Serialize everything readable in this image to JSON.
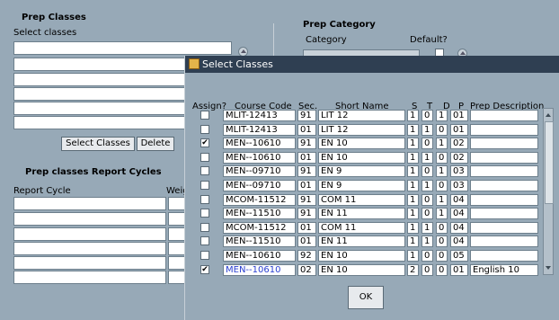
{
  "background": {
    "prep_classes_title": "Prep Classes",
    "select_classes_label": "Select classes",
    "select_classes_button": "Select Classes",
    "delete_button": "Delete",
    "report_cycles_title": "Prep classes Report Cycles",
    "report_cycle_col": "Report Cycle",
    "weight_col": "Weig",
    "prep_category_title": "Prep Category",
    "category_label": "Category",
    "default_label": "Default?"
  },
  "dialog": {
    "title": "Select Classes",
    "headers": {
      "assign": "Assign?",
      "course_code": "Course Code",
      "sec": "Sec.",
      "short_name": "Short Name",
      "s": "S",
      "t": "T",
      "d": "D",
      "p": "P",
      "prep_description": "Prep Description"
    },
    "rows": [
      {
        "assign": false,
        "code": "MLIT-12413",
        "sec": "91",
        "short": "LIT 12",
        "s": "1",
        "t": "0",
        "d": "1",
        "p": "01",
        "desc": ""
      },
      {
        "assign": false,
        "code": "MLIT-12413",
        "sec": "01",
        "short": "LIT 12",
        "s": "1",
        "t": "1",
        "d": "0",
        "p": "01",
        "desc": ""
      },
      {
        "assign": true,
        "code": "MEN--10610",
        "sec": "91",
        "short": "EN 10",
        "s": "1",
        "t": "0",
        "d": "1",
        "p": "02",
        "desc": ""
      },
      {
        "assign": false,
        "code": "MEN--10610",
        "sec": "01",
        "short": "EN 10",
        "s": "1",
        "t": "1",
        "d": "0",
        "p": "02",
        "desc": ""
      },
      {
        "assign": false,
        "code": "MEN--09710",
        "sec": "91",
        "short": "EN 9",
        "s": "1",
        "t": "0",
        "d": "1",
        "p": "03",
        "desc": ""
      },
      {
        "assign": false,
        "code": "MEN--09710",
        "sec": "01",
        "short": "EN 9",
        "s": "1",
        "t": "1",
        "d": "0",
        "p": "03",
        "desc": ""
      },
      {
        "assign": false,
        "code": "MCOM-11512",
        "sec": "91",
        "short": "COM 11",
        "s": "1",
        "t": "0",
        "d": "1",
        "p": "04",
        "desc": ""
      },
      {
        "assign": false,
        "code": "MEN--11510",
        "sec": "91",
        "short": "EN 11",
        "s": "1",
        "t": "0",
        "d": "1",
        "p": "04",
        "desc": ""
      },
      {
        "assign": false,
        "code": "MCOM-11512",
        "sec": "01",
        "short": "COM 11",
        "s": "1",
        "t": "1",
        "d": "0",
        "p": "04",
        "desc": ""
      },
      {
        "assign": false,
        "code": "MEN--11510",
        "sec": "01",
        "short": "EN 11",
        "s": "1",
        "t": "1",
        "d": "0",
        "p": "04",
        "desc": ""
      },
      {
        "assign": false,
        "code": "MEN--10610",
        "sec": "92",
        "short": "EN 10",
        "s": "1",
        "t": "0",
        "d": "0",
        "p": "05",
        "desc": ""
      },
      {
        "assign": true,
        "code": "MEN--10610",
        "sec": "02",
        "short": "EN 10",
        "s": "2",
        "t": "0",
        "d": "0",
        "p": "01",
        "desc": "English 10",
        "highlight": true
      }
    ],
    "ok_button": "OK"
  },
  "colors": {
    "background": "#97a9b7",
    "titlebar": "#2f3f52",
    "link": "#2a3fd0"
  },
  "icons": [
    "app-icon",
    "checkbox",
    "scroll-up-arrow",
    "scroll-down-arrow",
    "list-button-icon"
  ]
}
